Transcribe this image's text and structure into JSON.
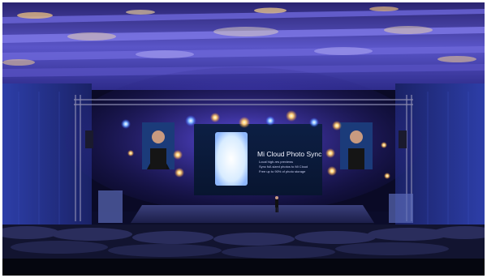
{
  "slide": {
    "title": "Mi Cloud Photo Sync",
    "lines": [
      "Local high-res previews",
      "Sync full-sized photos to Mi Cloud",
      "Free up to 90% of photo storage"
    ]
  },
  "colors": {
    "stage_glow": "#3b2fd9",
    "ceiling_light": "#ffd27a",
    "screen_bg": "#0c1b3a",
    "phone_glow": "#eef6ff"
  }
}
